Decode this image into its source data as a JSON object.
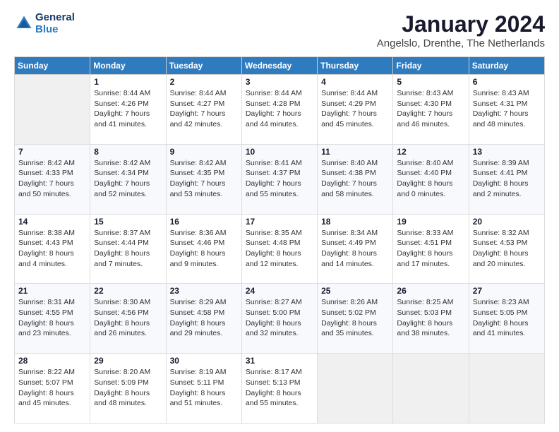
{
  "header": {
    "logo_line1": "General",
    "logo_line2": "Blue",
    "title": "January 2024",
    "subtitle": "Angelslo, Drenthe, The Netherlands"
  },
  "days_of_week": [
    "Sunday",
    "Monday",
    "Tuesday",
    "Wednesday",
    "Thursday",
    "Friday",
    "Saturday"
  ],
  "weeks": [
    [
      {
        "day": "",
        "sunrise": "",
        "sunset": "",
        "daylight": ""
      },
      {
        "day": "1",
        "sunrise": "Sunrise: 8:44 AM",
        "sunset": "Sunset: 4:26 PM",
        "daylight": "Daylight: 7 hours and 41 minutes."
      },
      {
        "day": "2",
        "sunrise": "Sunrise: 8:44 AM",
        "sunset": "Sunset: 4:27 PM",
        "daylight": "Daylight: 7 hours and 42 minutes."
      },
      {
        "day": "3",
        "sunrise": "Sunrise: 8:44 AM",
        "sunset": "Sunset: 4:28 PM",
        "daylight": "Daylight: 7 hours and 44 minutes."
      },
      {
        "day": "4",
        "sunrise": "Sunrise: 8:44 AM",
        "sunset": "Sunset: 4:29 PM",
        "daylight": "Daylight: 7 hours and 45 minutes."
      },
      {
        "day": "5",
        "sunrise": "Sunrise: 8:43 AM",
        "sunset": "Sunset: 4:30 PM",
        "daylight": "Daylight: 7 hours and 46 minutes."
      },
      {
        "day": "6",
        "sunrise": "Sunrise: 8:43 AM",
        "sunset": "Sunset: 4:31 PM",
        "daylight": "Daylight: 7 hours and 48 minutes."
      }
    ],
    [
      {
        "day": "7",
        "sunrise": "Sunrise: 8:42 AM",
        "sunset": "Sunset: 4:33 PM",
        "daylight": "Daylight: 7 hours and 50 minutes."
      },
      {
        "day": "8",
        "sunrise": "Sunrise: 8:42 AM",
        "sunset": "Sunset: 4:34 PM",
        "daylight": "Daylight: 7 hours and 52 minutes."
      },
      {
        "day": "9",
        "sunrise": "Sunrise: 8:42 AM",
        "sunset": "Sunset: 4:35 PM",
        "daylight": "Daylight: 7 hours and 53 minutes."
      },
      {
        "day": "10",
        "sunrise": "Sunrise: 8:41 AM",
        "sunset": "Sunset: 4:37 PM",
        "daylight": "Daylight: 7 hours and 55 minutes."
      },
      {
        "day": "11",
        "sunrise": "Sunrise: 8:40 AM",
        "sunset": "Sunset: 4:38 PM",
        "daylight": "Daylight: 7 hours and 58 minutes."
      },
      {
        "day": "12",
        "sunrise": "Sunrise: 8:40 AM",
        "sunset": "Sunset: 4:40 PM",
        "daylight": "Daylight: 8 hours and 0 minutes."
      },
      {
        "day": "13",
        "sunrise": "Sunrise: 8:39 AM",
        "sunset": "Sunset: 4:41 PM",
        "daylight": "Daylight: 8 hours and 2 minutes."
      }
    ],
    [
      {
        "day": "14",
        "sunrise": "Sunrise: 8:38 AM",
        "sunset": "Sunset: 4:43 PM",
        "daylight": "Daylight: 8 hours and 4 minutes."
      },
      {
        "day": "15",
        "sunrise": "Sunrise: 8:37 AM",
        "sunset": "Sunset: 4:44 PM",
        "daylight": "Daylight: 8 hours and 7 minutes."
      },
      {
        "day": "16",
        "sunrise": "Sunrise: 8:36 AM",
        "sunset": "Sunset: 4:46 PM",
        "daylight": "Daylight: 8 hours and 9 minutes."
      },
      {
        "day": "17",
        "sunrise": "Sunrise: 8:35 AM",
        "sunset": "Sunset: 4:48 PM",
        "daylight": "Daylight: 8 hours and 12 minutes."
      },
      {
        "day": "18",
        "sunrise": "Sunrise: 8:34 AM",
        "sunset": "Sunset: 4:49 PM",
        "daylight": "Daylight: 8 hours and 14 minutes."
      },
      {
        "day": "19",
        "sunrise": "Sunrise: 8:33 AM",
        "sunset": "Sunset: 4:51 PM",
        "daylight": "Daylight: 8 hours and 17 minutes."
      },
      {
        "day": "20",
        "sunrise": "Sunrise: 8:32 AM",
        "sunset": "Sunset: 4:53 PM",
        "daylight": "Daylight: 8 hours and 20 minutes."
      }
    ],
    [
      {
        "day": "21",
        "sunrise": "Sunrise: 8:31 AM",
        "sunset": "Sunset: 4:55 PM",
        "daylight": "Daylight: 8 hours and 23 minutes."
      },
      {
        "day": "22",
        "sunrise": "Sunrise: 8:30 AM",
        "sunset": "Sunset: 4:56 PM",
        "daylight": "Daylight: 8 hours and 26 minutes."
      },
      {
        "day": "23",
        "sunrise": "Sunrise: 8:29 AM",
        "sunset": "Sunset: 4:58 PM",
        "daylight": "Daylight: 8 hours and 29 minutes."
      },
      {
        "day": "24",
        "sunrise": "Sunrise: 8:27 AM",
        "sunset": "Sunset: 5:00 PM",
        "daylight": "Daylight: 8 hours and 32 minutes."
      },
      {
        "day": "25",
        "sunrise": "Sunrise: 8:26 AM",
        "sunset": "Sunset: 5:02 PM",
        "daylight": "Daylight: 8 hours and 35 minutes."
      },
      {
        "day": "26",
        "sunrise": "Sunrise: 8:25 AM",
        "sunset": "Sunset: 5:03 PM",
        "daylight": "Daylight: 8 hours and 38 minutes."
      },
      {
        "day": "27",
        "sunrise": "Sunrise: 8:23 AM",
        "sunset": "Sunset: 5:05 PM",
        "daylight": "Daylight: 8 hours and 41 minutes."
      }
    ],
    [
      {
        "day": "28",
        "sunrise": "Sunrise: 8:22 AM",
        "sunset": "Sunset: 5:07 PM",
        "daylight": "Daylight: 8 hours and 45 minutes."
      },
      {
        "day": "29",
        "sunrise": "Sunrise: 8:20 AM",
        "sunset": "Sunset: 5:09 PM",
        "daylight": "Daylight: 8 hours and 48 minutes."
      },
      {
        "day": "30",
        "sunrise": "Sunrise: 8:19 AM",
        "sunset": "Sunset: 5:11 PM",
        "daylight": "Daylight: 8 hours and 51 minutes."
      },
      {
        "day": "31",
        "sunrise": "Sunrise: 8:17 AM",
        "sunset": "Sunset: 5:13 PM",
        "daylight": "Daylight: 8 hours and 55 minutes."
      },
      {
        "day": "",
        "sunrise": "",
        "sunset": "",
        "daylight": ""
      },
      {
        "day": "",
        "sunrise": "",
        "sunset": "",
        "daylight": ""
      },
      {
        "day": "",
        "sunrise": "",
        "sunset": "",
        "daylight": ""
      }
    ]
  ]
}
